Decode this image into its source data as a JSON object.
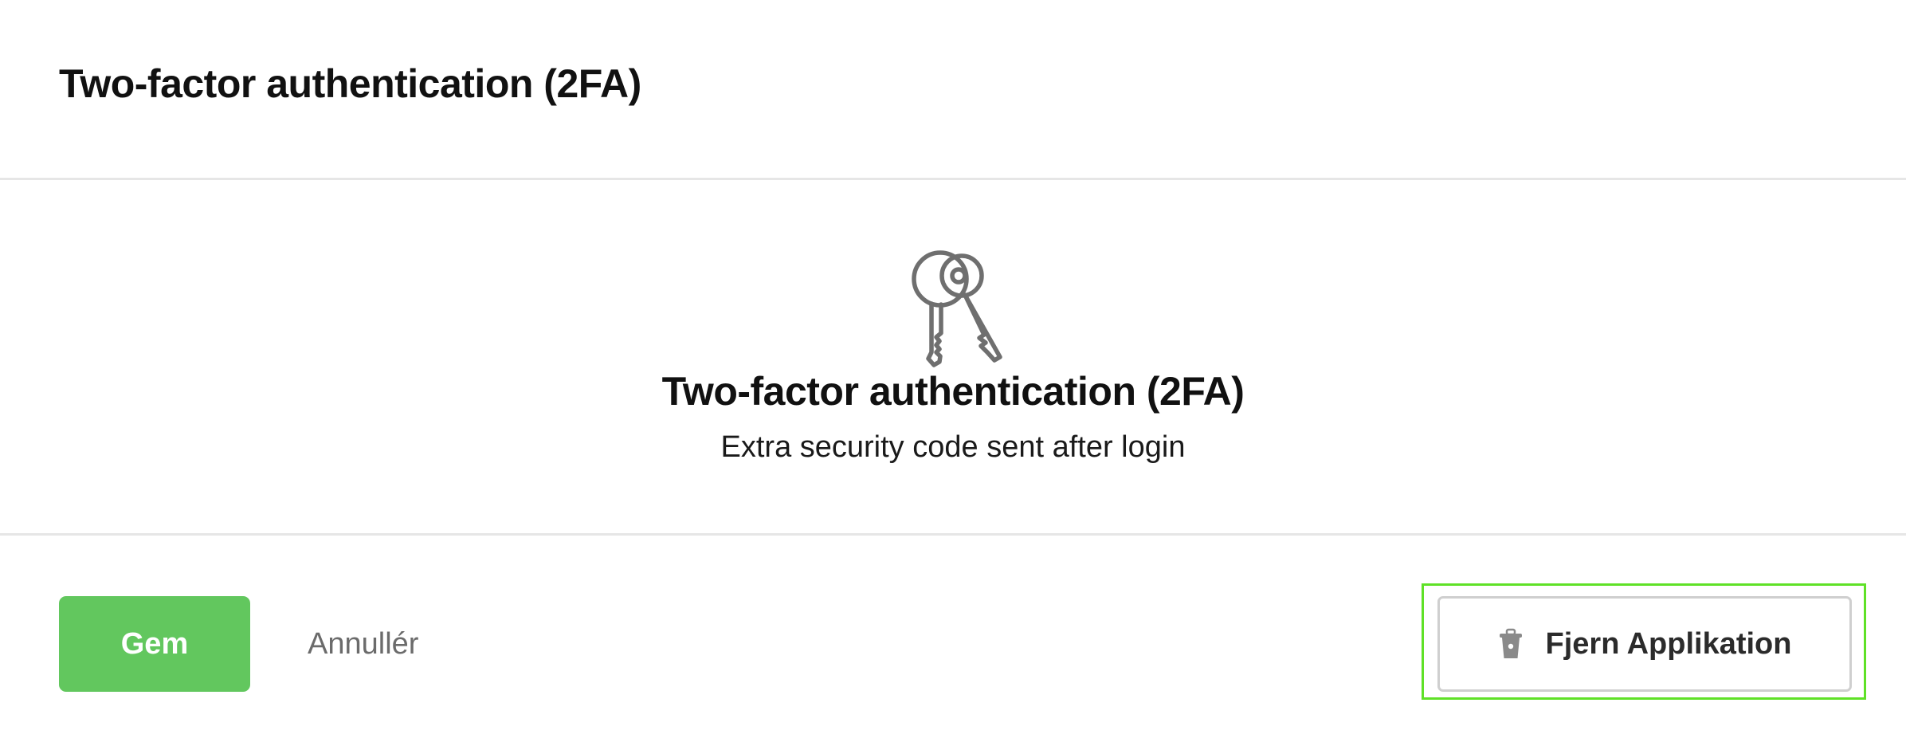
{
  "header": {
    "title": "Two-factor authentication (2FA)"
  },
  "main": {
    "icon": "keys-icon",
    "title": "Two-factor authentication (2FA)",
    "subtitle": "Extra security code sent after login"
  },
  "footer": {
    "save_label": "Gem",
    "cancel_label": "Annullér",
    "remove_label": "Fjern Applikation",
    "remove_icon": "trash-icon"
  },
  "colors": {
    "save_button": "#62c75e",
    "highlight": "#5fe127",
    "divider": "#e6e6e6",
    "icon_gray": "#6f6f6f"
  }
}
